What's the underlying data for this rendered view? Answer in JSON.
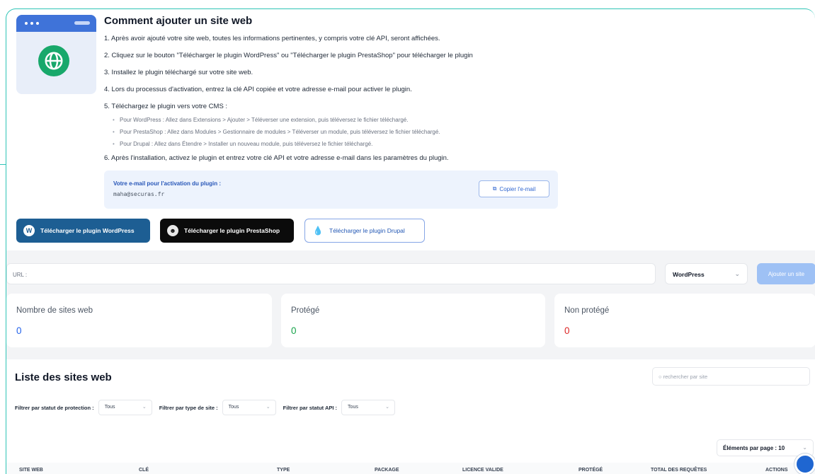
{
  "instructions": {
    "title": "Comment ajouter un site web",
    "steps": [
      "1. Après avoir ajouté votre site web, toutes les informations pertinentes, y compris votre clé API, seront affichées.",
      "2. Cliquez sur le bouton \"Télécharger le plugin WordPress\" ou \"Télécharger le plugin PrestaShop\" pour télécharger le plugin",
      "3. Installez le plugin téléchargé sur votre site web.",
      "4. Lors du processus d'activation, entrez la clé API copiée et votre adresse e-mail pour activer le plugin.",
      "5. Téléchargez le plugin vers votre CMS :"
    ],
    "substeps": [
      "Pour WordPress : Allez dans Extensions > Ajouter > Téléverser une extension, puis téléversez le fichier téléchargé.",
      "Pour PrestaShop : Allez dans Modules > Gestionnaire de modules > Téléverser un module, puis téléversez le fichier téléchargé.",
      "Pour Drupal : Allez dans Étendre > Installer un nouveau module, puis téléversez le fichier téléchargé."
    ],
    "step6": "6. Après l'installation, activez le plugin et entrez votre clé API et votre adresse e-mail dans les paramètres du plugin."
  },
  "email_box": {
    "label": "Votre e-mail pour l'activation du plugin :",
    "value": "maha@securas.fr",
    "copy_button": "Copier l'e-mail"
  },
  "downloads": {
    "wordpress": "Télécharger le plugin WordPress",
    "prestashop": "Télécharger le plugin PrestaShop",
    "drupal": "Télécharger le plugin Drupal"
  },
  "add_site": {
    "url_placeholder": "URL :",
    "cms_selected": "WordPress",
    "add_button": "Ajouter un site"
  },
  "stats": [
    {
      "title": "Nombre de sites web",
      "value": "0",
      "color": "#2563eb"
    },
    {
      "title": "Protégé",
      "value": "0",
      "color": "#16a34a"
    },
    {
      "title": "Non protégé",
      "value": "0",
      "color": "#dc2626"
    }
  ],
  "list": {
    "title": "Liste des sites web",
    "search_placeholder": "rechercher par site",
    "filter_protection_label": "Filtrer par statut de protection :",
    "filter_protection_value": "Tous",
    "filter_type_label": "Filtrer par type de site :",
    "filter_type_value": "Tous",
    "filter_api_label": "Filtrer par statut API :",
    "filter_api_value": "Tous",
    "per_page": "Éléments par page : 10",
    "columns": {
      "site": "SITE WEB",
      "key": "CLÉ",
      "type": "TYPE",
      "package": "PACKAGE",
      "license": "LICENCE VALIDE JUSQU'AU",
      "protected": "PROTÉGÉ",
      "requests": "TOTAL DES REQUÊTES",
      "actions": "ACTIONS"
    }
  },
  "colors": {
    "accent": "#2ec4b6",
    "primary": "#1d5e93",
    "brand_blue": "#3f73d9"
  }
}
